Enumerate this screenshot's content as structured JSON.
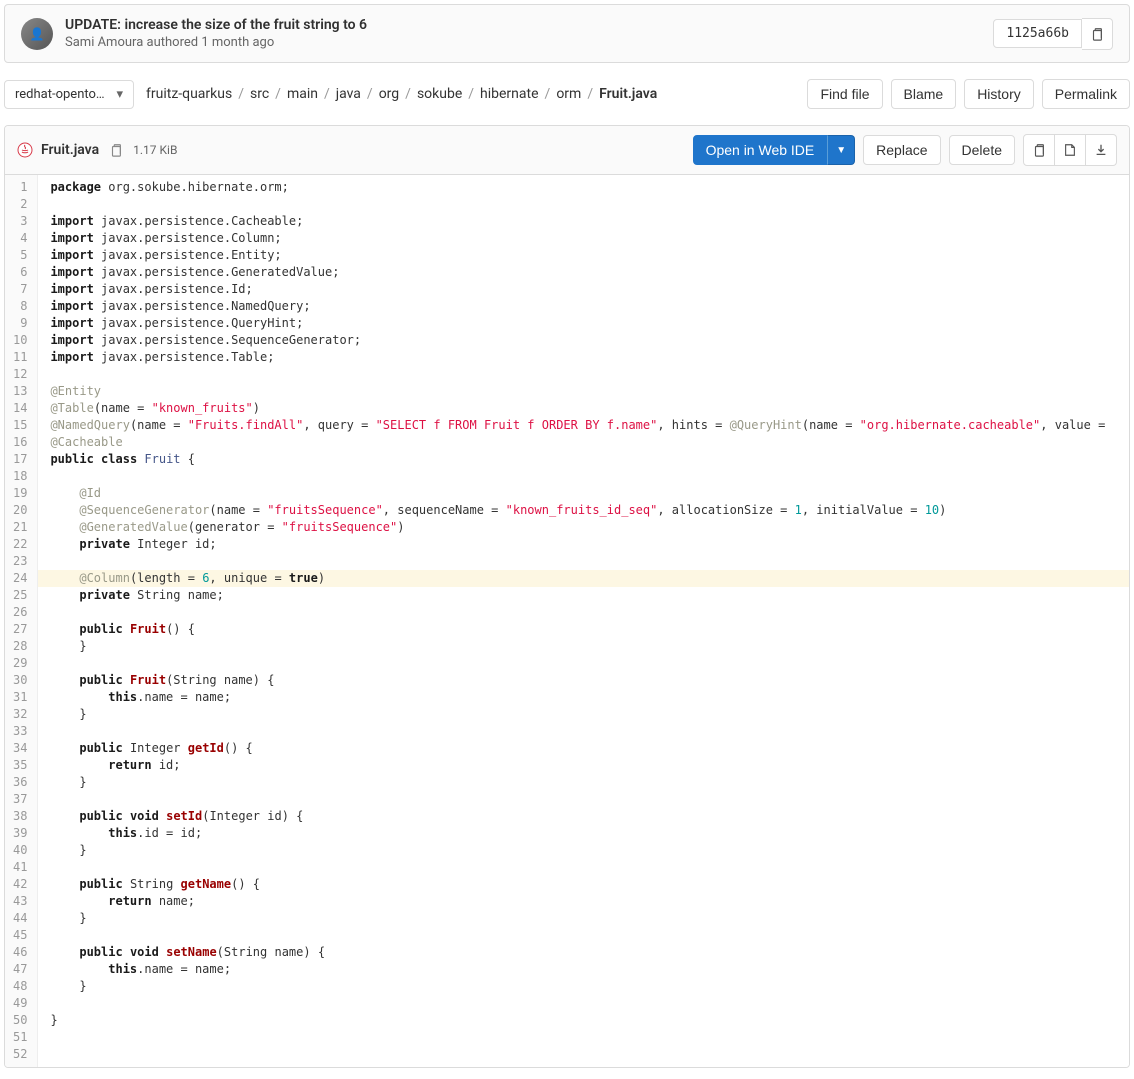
{
  "commit": {
    "title": "UPDATE: increase the size of the fruit string to 6",
    "author": "Sami Amoura",
    "authored": "authored",
    "time": "1 month ago",
    "sha": "1125a66b"
  },
  "branch": "redhat-opentour…",
  "breadcrumbs": [
    "fruitz-quarkus",
    "src",
    "main",
    "java",
    "org",
    "sokube",
    "hibernate",
    "orm",
    "Fruit.java"
  ],
  "nav_buttons": {
    "find": "Find file",
    "blame": "Blame",
    "history": "History",
    "permalink": "Permalink"
  },
  "file": {
    "name": "Fruit.java",
    "size": "1.17 KiB",
    "open_ide": "Open in Web IDE",
    "replace": "Replace",
    "delete": "Delete"
  },
  "code": {
    "highlight_line": 24,
    "lines": [
      {
        "t": "pkg",
        "pkg": "package",
        "rest": " org.sokube.hibernate.orm;"
      },
      {
        "t": "empty"
      },
      {
        "t": "imp",
        "rest": " javax.persistence.Cacheable;"
      },
      {
        "t": "imp",
        "rest": " javax.persistence.Column;"
      },
      {
        "t": "imp",
        "rest": " javax.persistence.Entity;"
      },
      {
        "t": "imp",
        "rest": " javax.persistence.GeneratedValue;"
      },
      {
        "t": "imp",
        "rest": " javax.persistence.Id;"
      },
      {
        "t": "imp",
        "rest": " javax.persistence.NamedQuery;"
      },
      {
        "t": "imp",
        "rest": " javax.persistence.QueryHint;"
      },
      {
        "t": "imp",
        "rest": " javax.persistence.SequenceGenerator;"
      },
      {
        "t": "imp",
        "rest": " javax.persistence.Table;"
      },
      {
        "t": "empty"
      },
      {
        "t": "ann",
        "text": "@Entity"
      },
      {
        "t": "tbl",
        "pre": "@Table",
        "p1": "(name = ",
        "s": "\"known_fruits\"",
        "p2": ")"
      },
      {
        "t": "nq"
      },
      {
        "t": "ann",
        "text": "@Cacheable"
      },
      {
        "t": "cls"
      },
      {
        "t": "empty"
      },
      {
        "t": "ann",
        "text": "    @Id"
      },
      {
        "t": "seq"
      },
      {
        "t": "gen",
        "pre": "    @GeneratedValue",
        "p1": "(generator = ",
        "s": "\"fruitsSequence\"",
        "p2": ")"
      },
      {
        "t": "fld",
        "ind": "    ",
        "mod": "private",
        "type": " Integer id;"
      },
      {
        "t": "empty"
      },
      {
        "t": "col"
      },
      {
        "t": "fld",
        "ind": "    ",
        "mod": "private",
        "type": " String name;"
      },
      {
        "t": "empty"
      },
      {
        "t": "ctor0"
      },
      {
        "t": "plain",
        "text": "    }"
      },
      {
        "t": "empty"
      },
      {
        "t": "ctor1"
      },
      {
        "t": "this",
        "ind": "        ",
        "rest": ".name = name;"
      },
      {
        "t": "plain",
        "text": "    }"
      },
      {
        "t": "empty"
      },
      {
        "t": "meth",
        "ind": "    ",
        "mod": "public",
        "ret": " Integer ",
        "name": "getId",
        "params": "()",
        "tail": " {"
      },
      {
        "t": "ret",
        "ind": "        ",
        "rest": " id;"
      },
      {
        "t": "plain",
        "text": "    }"
      },
      {
        "t": "empty"
      },
      {
        "t": "setid"
      },
      {
        "t": "this",
        "ind": "        ",
        "rest": ".id = id;"
      },
      {
        "t": "plain",
        "text": "    }"
      },
      {
        "t": "empty"
      },
      {
        "t": "meth",
        "ind": "    ",
        "mod": "public",
        "ret": " String ",
        "name": "getName",
        "params": "()",
        "tail": " {"
      },
      {
        "t": "ret",
        "ind": "        ",
        "rest": " name;"
      },
      {
        "t": "plain",
        "text": "    }"
      },
      {
        "t": "empty"
      },
      {
        "t": "setname"
      },
      {
        "t": "this",
        "ind": "        ",
        "rest": ".name = name;"
      },
      {
        "t": "plain",
        "text": "    }"
      },
      {
        "t": "empty"
      },
      {
        "t": "plain",
        "text": "}"
      },
      {
        "t": "empty"
      },
      {
        "t": "empty"
      }
    ]
  }
}
